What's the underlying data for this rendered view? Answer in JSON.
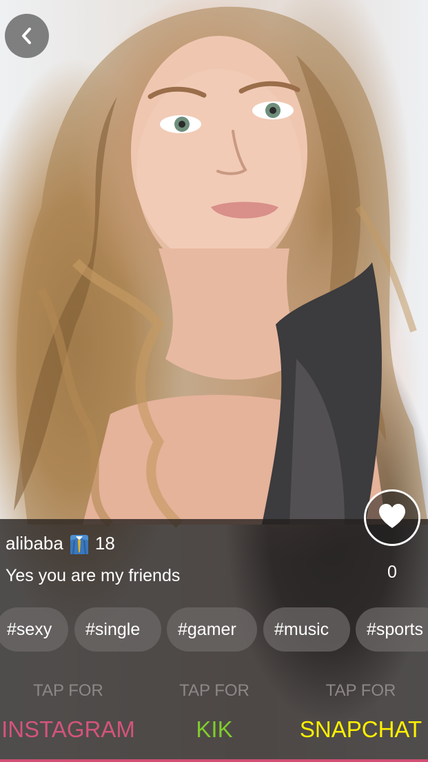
{
  "profile": {
    "username": "alibaba",
    "age": "18",
    "status": "Yes you are my friends",
    "likes": "0"
  },
  "icons": {
    "back": "chevron-left-icon",
    "like": "heart-icon",
    "badge": "businessman-emoji-icon"
  },
  "tags": [
    "#sexy",
    "#single",
    "#gamer",
    "#music",
    "#sports"
  ],
  "social": [
    {
      "tap_label": "TAP FOR",
      "name": "INSTAGRAM",
      "color": "#d4547a"
    },
    {
      "tap_label": "TAP FOR",
      "name": "KIK",
      "color": "#7fcd2b"
    },
    {
      "tap_label": "TAP FOR",
      "name": "SNAPCHAT",
      "color": "#fff000"
    }
  ],
  "colors": {
    "overlay": "#231f1e",
    "accent_bar": "#d14e73"
  }
}
